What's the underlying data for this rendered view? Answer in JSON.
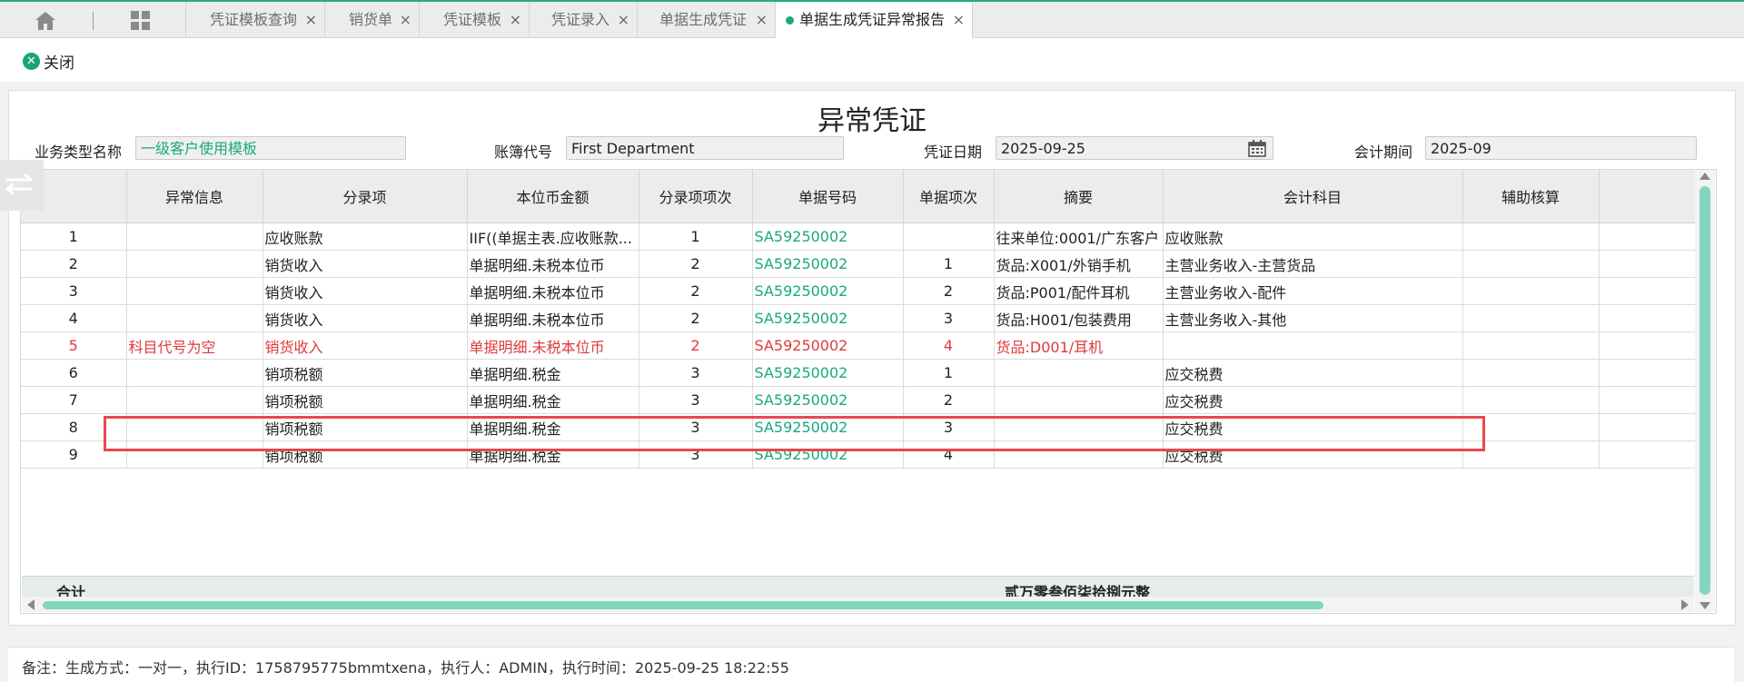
{
  "tabs": [
    {
      "label": "凭证模板查询",
      "active": false
    },
    {
      "label": "销货单",
      "active": false
    },
    {
      "label": "凭证模板",
      "active": false
    },
    {
      "label": "凭证录入",
      "active": false
    },
    {
      "label": "单据生成凭证",
      "active": false
    },
    {
      "label": "单据生成凭证异常报告",
      "active": true
    }
  ],
  "tab_close_glyph": "×",
  "toolbar": {
    "close_label": "关闭",
    "close_glyph": "✕"
  },
  "form": {
    "title": "异常凭证",
    "business_type_label": "业务类型名称",
    "business_type_value": "一级客户使用模板",
    "ledger_label": "账簿代号",
    "ledger_value": "First Department",
    "voucher_date_label": "凭证日期",
    "voucher_date_value": "2025-09-25",
    "period_label": "会计期间",
    "period_value": "2025-09"
  },
  "table": {
    "columns": [
      "",
      "异常信息",
      "分录项",
      "本位币金额",
      "分录项项次",
      "单据号码",
      "单据项次",
      "摘要",
      "会计科目",
      "辅助核算",
      ""
    ],
    "rows": [
      {
        "no": "1",
        "error": "",
        "entry": "应收账款",
        "amount": "IIF((单据主表.应收账款...",
        "entry_seq": "1",
        "doc_no": "SA59250002",
        "doc_seq": "",
        "summary": "往来单位:0001/广东客户",
        "account": "应收账款",
        "aux": "",
        "highlight": false
      },
      {
        "no": "2",
        "error": "",
        "entry": "销货收入",
        "amount": "单据明细.未税本位币",
        "entry_seq": "2",
        "doc_no": "SA59250002",
        "doc_seq": "1",
        "summary": "货品:X001/外销手机",
        "account": "主营业务收入-主营货品",
        "aux": "",
        "highlight": false
      },
      {
        "no": "3",
        "error": "",
        "entry": "销货收入",
        "amount": "单据明细.未税本位币",
        "entry_seq": "2",
        "doc_no": "SA59250002",
        "doc_seq": "2",
        "summary": "货品:P001/配件耳机",
        "account": "主营业务收入-配件",
        "aux": "",
        "highlight": false
      },
      {
        "no": "4",
        "error": "",
        "entry": "销货收入",
        "amount": "单据明细.未税本位币",
        "entry_seq": "2",
        "doc_no": "SA59250002",
        "doc_seq": "3",
        "summary": "货品:H001/包装费用",
        "account": "主营业务收入-其他",
        "aux": "",
        "highlight": false
      },
      {
        "no": "5",
        "error": "科目代号为空",
        "entry": "销货收入",
        "amount": "单据明细.未税本位币",
        "entry_seq": "2",
        "doc_no": "SA59250002",
        "doc_seq": "4",
        "summary": "货品:D001/耳机",
        "account": "",
        "aux": "",
        "highlight": true
      },
      {
        "no": "6",
        "error": "",
        "entry": "销项税额",
        "amount": "单据明细.税金",
        "entry_seq": "3",
        "doc_no": "SA59250002",
        "doc_seq": "1",
        "summary": "",
        "account": "应交税费",
        "aux": "",
        "highlight": false
      },
      {
        "no": "7",
        "error": "",
        "entry": "销项税额",
        "amount": "单据明细.税金",
        "entry_seq": "3",
        "doc_no": "SA59250002",
        "doc_seq": "2",
        "summary": "",
        "account": "应交税费",
        "aux": "",
        "highlight": false
      },
      {
        "no": "8",
        "error": "",
        "entry": "销项税额",
        "amount": "单据明细.税金",
        "entry_seq": "3",
        "doc_no": "SA59250002",
        "doc_seq": "3",
        "summary": "",
        "account": "应交税费",
        "aux": "",
        "highlight": false
      },
      {
        "no": "9",
        "error": "",
        "entry": "销项税额",
        "amount": "单据明细.税金",
        "entry_seq": "3",
        "doc_no": "SA59250002",
        "doc_seq": "4",
        "summary": "",
        "account": "应交税费",
        "aux": "",
        "highlight": false
      }
    ],
    "total_label": "合计",
    "total_amount": "贰万零叁佰柒拾捌元整"
  },
  "footer_note": "备注：生成方式：一对一，执行ID：1758795775bmmtxena，执行人：ADMIN，执行时间：2025-09-25 18:22:55",
  "colors": {
    "accent": "#19a97c",
    "error": "#e03a3a",
    "scroll": "#82d6bd"
  },
  "icons": {
    "home": "home-icon",
    "grid": "grid-icon",
    "calendar": "calendar-icon",
    "close": "close-circle-icon",
    "side": "swap-icon"
  }
}
